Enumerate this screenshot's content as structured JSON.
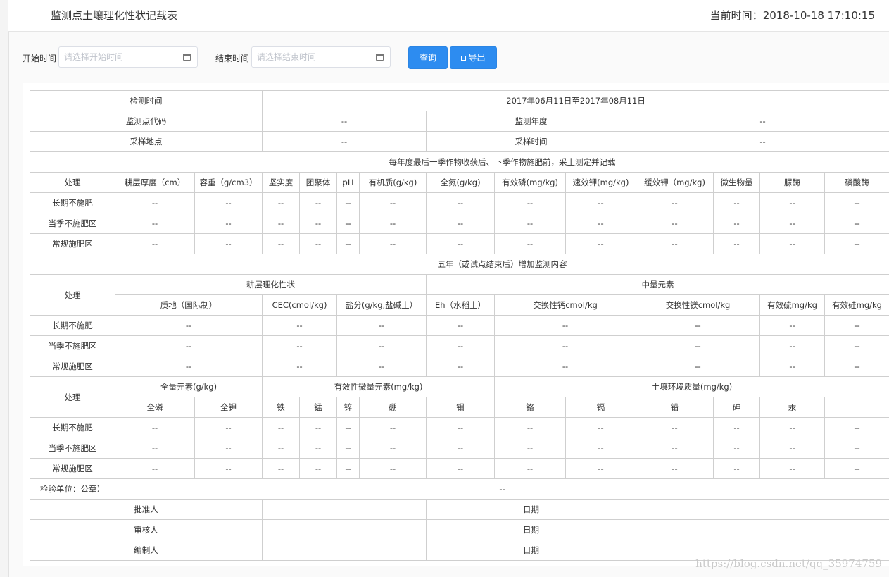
{
  "header": {
    "title": "监测点土壤理化性状记载表",
    "clock_prefix": "当前时间：",
    "clock_value": "2018-10-18 17:10:15"
  },
  "filters": {
    "start_label": "开始时间",
    "start_placeholder": "请选择开始时间",
    "end_label": "结束时间",
    "end_placeholder": "请选择结束时间",
    "query_label": "查询",
    "export_label": "导出"
  },
  "placeholder_cell": "--",
  "record": {
    "detect_time_label": "检测时间",
    "detect_time_value": "2017年06月11日至2017年08月11日",
    "site_code_label": "监测点代码",
    "site_code_value": "--",
    "year_label": "监测年度",
    "year_value": "--",
    "location_label": "采样地点",
    "location_value": "--",
    "sample_time_label": "采样时间",
    "sample_time_value": "--",
    "section1_title": "每年度最后一季作物收获后、下季作物施肥前，采土测定并记载",
    "section2_title": "五年（或试点结束后）增加监测内容",
    "treatment_label": "处理",
    "treatments": [
      "长期不施肥",
      "当季不施肥区",
      "常规施肥区"
    ],
    "section1_headers": [
      "耕层厚度（cm）",
      "容重（g/cm3）",
      "坚实度",
      "团聚体",
      "pH",
      "有机质(g/kg)",
      "全氮(g/kg)",
      "有效磷(mg/kg)",
      "速效钾(mg/kg)",
      "缓效钾（mg/kg)",
      "微生物量",
      "脲酶",
      "磷酸酶"
    ],
    "section2_group1": "耕层理化性状",
    "section2_group2": "中量元素",
    "section2_headers": [
      "质地（国际制）",
      "CEC(cmol/kg)",
      "盐分(g/kg,盐碱土）",
      "Eh（水稻土）",
      "交换性钙cmol/kg",
      "交换性镁cmol/kg",
      "有效硫mg/kg",
      "有效硅mg/kg"
    ],
    "section3_group1": "全量元素(g/kg)",
    "section3_group2": "有效性微量元素(mg/kg)",
    "section3_group3": "土壤环境质量(mg/kg)",
    "section3_headers": [
      "全磷",
      "全钾",
      "铁",
      "锰",
      "锌",
      "硼",
      "钼",
      "铬",
      "镉",
      "铅",
      "砷",
      "汞",
      ""
    ],
    "inspection_label": "检验单位：公章）",
    "inspection_value": "--",
    "signoff": [
      {
        "role": "批准人",
        "date_label": "日期"
      },
      {
        "role": "审核人",
        "date_label": "日期"
      },
      {
        "role": "编制人",
        "date_label": "日期"
      }
    ]
  },
  "watermark": "https://blog.csdn.net/qq_35974759"
}
